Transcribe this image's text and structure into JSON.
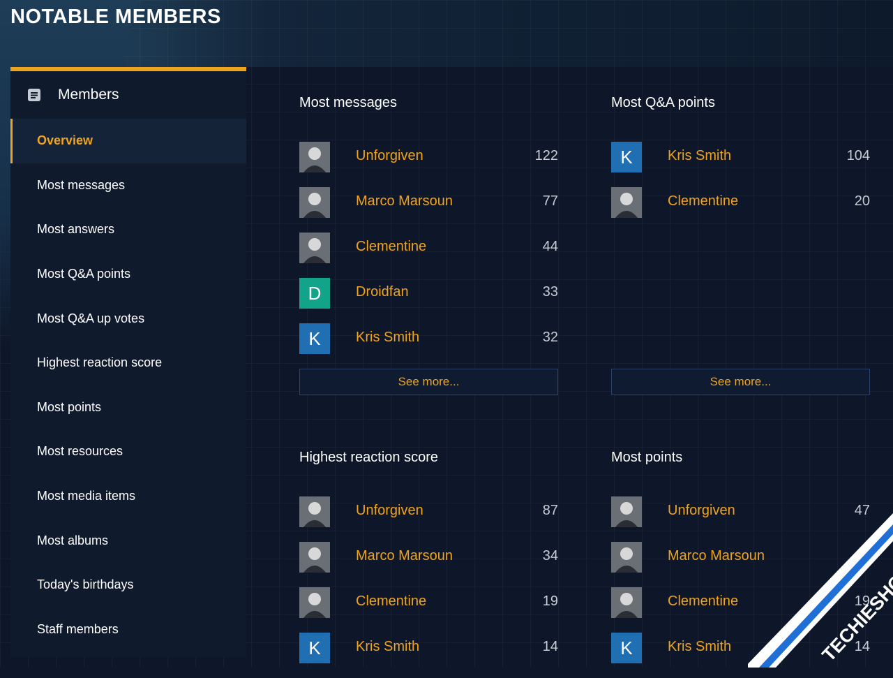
{
  "page": {
    "title": "NOTABLE MEMBERS"
  },
  "sidebar": {
    "header_icon": "list-icon",
    "title": "Members",
    "items": [
      {
        "label": "Overview",
        "active": true
      },
      {
        "label": "Most messages",
        "active": false
      },
      {
        "label": "Most answers",
        "active": false
      },
      {
        "label": "Most Q&A points",
        "active": false
      },
      {
        "label": "Most Q&A up votes",
        "active": false
      },
      {
        "label": "Highest reaction score",
        "active": false
      },
      {
        "label": "Most points",
        "active": false
      },
      {
        "label": "Most resources",
        "active": false
      },
      {
        "label": "Most media items",
        "active": false
      },
      {
        "label": "Most albums",
        "active": false
      },
      {
        "label": "Today's birthdays",
        "active": false
      },
      {
        "label": "Staff members",
        "active": false
      }
    ]
  },
  "blocks": [
    {
      "title": "Most messages",
      "see_more": "See more...",
      "members": [
        {
          "name": "Unforgiven",
          "value": "122",
          "avatar": "photo"
        },
        {
          "name": "Marco Marsoun",
          "value": "77",
          "avatar": "photo"
        },
        {
          "name": "Clementine",
          "value": "44",
          "avatar": "photo"
        },
        {
          "name": "Droidfan",
          "value": "33",
          "avatar": "D",
          "avatar_color": "#12a38b"
        },
        {
          "name": "Kris Smith",
          "value": "32",
          "avatar": "K",
          "avatar_color": "#1f6fb2"
        }
      ]
    },
    {
      "title": "Most Q&A points",
      "see_more": "See more...",
      "members": [
        {
          "name": "Kris Smith",
          "value": "104",
          "avatar": "K",
          "avatar_color": "#1f6fb2"
        },
        {
          "name": "Clementine",
          "value": "20",
          "avatar": "photo"
        }
      ]
    },
    {
      "title": "Highest reaction score",
      "members": [
        {
          "name": "Unforgiven",
          "value": "87",
          "avatar": "photo"
        },
        {
          "name": "Marco Marsoun",
          "value": "34",
          "avatar": "photo"
        },
        {
          "name": "Clementine",
          "value": "19",
          "avatar": "photo"
        },
        {
          "name": "Kris Smith",
          "value": "14",
          "avatar": "K",
          "avatar_color": "#1f6fb2"
        }
      ]
    },
    {
      "title": "Most points",
      "members": [
        {
          "name": "Unforgiven",
          "value": "47",
          "avatar": "photo"
        },
        {
          "name": "Marco Marsoun",
          "value": "",
          "avatar": "photo"
        },
        {
          "name": "Clementine",
          "value": "19",
          "avatar": "photo"
        },
        {
          "name": "Kris Smith",
          "value": "14",
          "avatar": "K",
          "avatar_color": "#1f6fb2"
        }
      ]
    }
  ],
  "watermark": {
    "text": "TECHIESHOME.COM"
  },
  "colors": {
    "accent": "#f0a31d",
    "background": "#0e1729",
    "panel": "#0f1a2c"
  }
}
